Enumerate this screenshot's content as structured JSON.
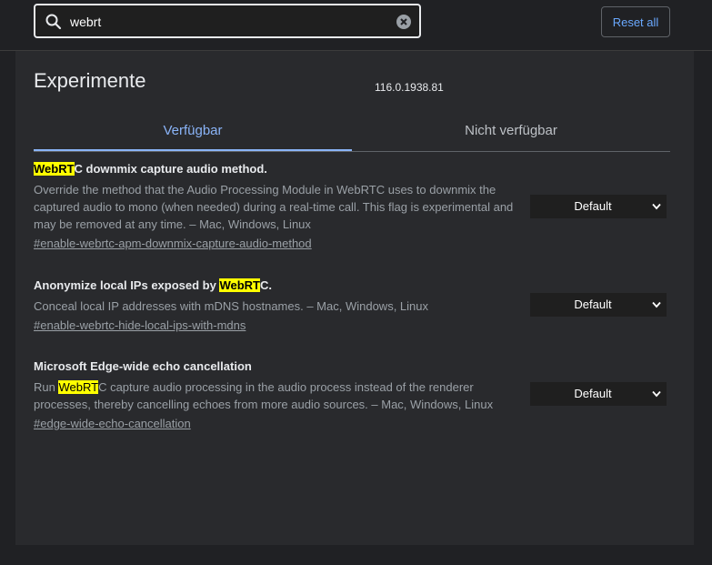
{
  "search": {
    "value": "webrt",
    "placeholder": ""
  },
  "header": {
    "reset_label": "Reset all"
  },
  "page": {
    "title": "Experimente",
    "version": "116.0.1938.81"
  },
  "tabs": [
    {
      "label": "Verfügbar",
      "active": true
    },
    {
      "label": "Nicht verfügbar",
      "active": false
    }
  ],
  "experiments": [
    {
      "title_pre": "",
      "title_mark": "WebRT",
      "title_post": "C downmix capture audio method.",
      "description": "Override the method that the Audio Processing Module in WebRTC uses to downmix the captured audio to mono (when needed) during a real-time call. This flag is experimental and may be removed at any time. – Mac, Windows, Linux",
      "desc_pre": "",
      "desc_mark": "",
      "desc_post": "",
      "link": "#enable-webrtc-apm-downmix-capture-audio-method",
      "select_value": "Default"
    },
    {
      "title_pre": "Anonymize local IPs exposed by ",
      "title_mark": "WebRT",
      "title_post": "C.",
      "description": "Conceal local IP addresses with mDNS hostnames. – Mac, Windows, Linux",
      "link": "#enable-webrtc-hide-local-ips-with-mdns",
      "select_value": "Default"
    },
    {
      "title": "Microsoft Edge-wide echo cancellation",
      "desc_pre": "Run ",
      "desc_mark": "WebRT",
      "desc_post": "C capture audio processing in the audio process instead of the renderer processes, thereby cancelling echoes from more audio sources. – Mac, Windows, Linux",
      "link": "#edge-wide-echo-cancellation",
      "select_value": "Default"
    }
  ],
  "colors": {
    "accent": "#8ab4f8",
    "highlight": "#ffff00",
    "background": "#202124",
    "panel": "#292a2d"
  }
}
